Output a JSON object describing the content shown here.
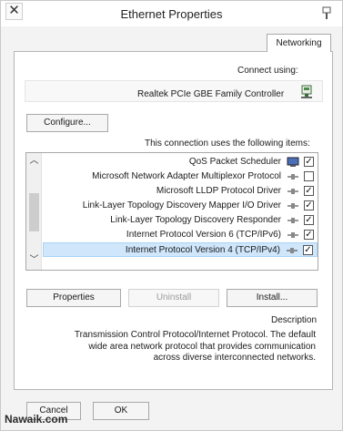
{
  "window": {
    "title": "Ethernet Properties",
    "close_glyph": "✕",
    "title_icon": "tray-icon"
  },
  "tabs": [
    {
      "label": "Networking",
      "active": true
    }
  ],
  "connect": {
    "label": "Connect using:",
    "adapter_name": "Realtek PCIe GBE Family Controller",
    "adapter_icon": "network-adapter-icon"
  },
  "buttons": {
    "configure": "Configure...",
    "install": "Install...",
    "uninstall": "Uninstall",
    "properties": "Properties",
    "ok": "OK",
    "cancel": "Cancel"
  },
  "items_label": "This connection uses the following items:",
  "items": [
    {
      "label": "QoS Packet Scheduler",
      "checked": true,
      "icon": "qos-scheduler-icon"
    },
    {
      "label": "Microsoft Network Adapter Multiplexor Protocol",
      "checked": false,
      "icon": "protocol-icon"
    },
    {
      "label": "Microsoft LLDP Protocol Driver",
      "checked": true,
      "icon": "protocol-icon"
    },
    {
      "label": "Link-Layer Topology Discovery Mapper I/O Driver",
      "checked": true,
      "icon": "protocol-icon"
    },
    {
      "label": "Link-Layer Topology Discovery Responder",
      "checked": true,
      "icon": "protocol-icon"
    },
    {
      "label": "Internet Protocol Version 6 (TCP/IPv6)",
      "checked": true,
      "icon": "protocol-icon"
    },
    {
      "label": "Internet Protocol Version 4 (TCP/IPv4)",
      "checked": true,
      "icon": "protocol-icon",
      "selected": true
    }
  ],
  "description": {
    "label": "Description",
    "lines": [
      "Transmission Control Protocol/Internet Protocol. The default",
      "wide area network protocol that provides communication",
      "across diverse interconnected networks."
    ]
  },
  "watermark": "Nawaik.com",
  "colors": {
    "selection": "#cfe6fb",
    "selection_border": "#a9d3f6",
    "panel_border": "#b5b5b5"
  }
}
